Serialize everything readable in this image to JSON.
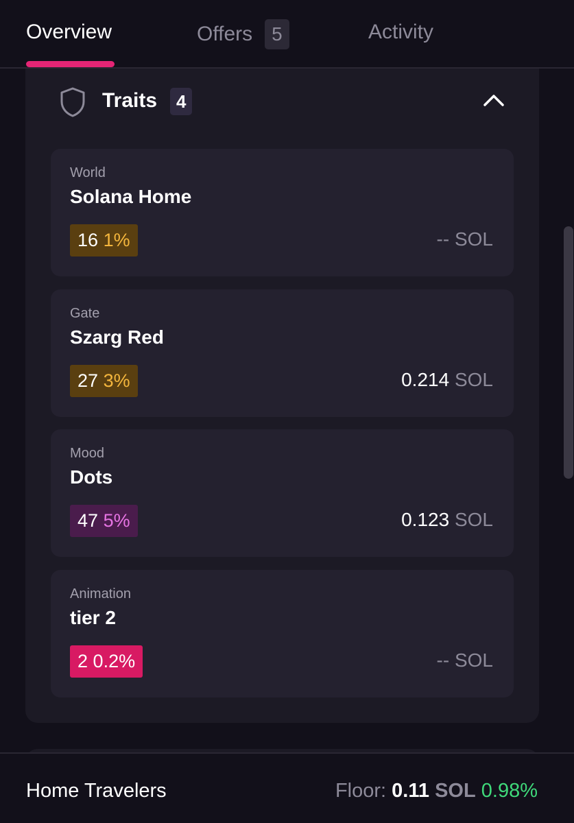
{
  "tabs": [
    {
      "label": "Overview",
      "active": true
    },
    {
      "label": "Offers",
      "count": "5",
      "active": false
    },
    {
      "label": "Activity",
      "active": false
    }
  ],
  "traits": {
    "title": "Traits",
    "count": "4",
    "icon": "shield-icon",
    "collapse_icon": "chevron-up-icon",
    "items": [
      {
        "type": "World",
        "value": "Solana Home",
        "count": "16",
        "percent": "1%",
        "rarity_color": "gold",
        "price": "--",
        "unit": "SOL"
      },
      {
        "type": "Gate",
        "value": "Szarg Red",
        "count": "27",
        "percent": "3%",
        "rarity_color": "gold",
        "price": "0.214",
        "unit": "SOL"
      },
      {
        "type": "Mood",
        "value": "Dots",
        "count": "47",
        "percent": "5%",
        "rarity_color": "purple",
        "price": "0.123",
        "unit": "SOL"
      },
      {
        "type": "Animation",
        "value": "tier 2",
        "count": "2",
        "percent": "0.2%",
        "rarity_color": "red",
        "price": "--",
        "unit": "SOL"
      }
    ]
  },
  "footer": {
    "collection_name": "Home Travelers",
    "floor_label": "Floor:",
    "floor_value": "0.11",
    "floor_unit": "SOL",
    "floor_change": "0.98%"
  },
  "colors": {
    "accent": "#e42575",
    "background": "#12101a",
    "card": "#24212f",
    "positive": "#3fd97a"
  }
}
